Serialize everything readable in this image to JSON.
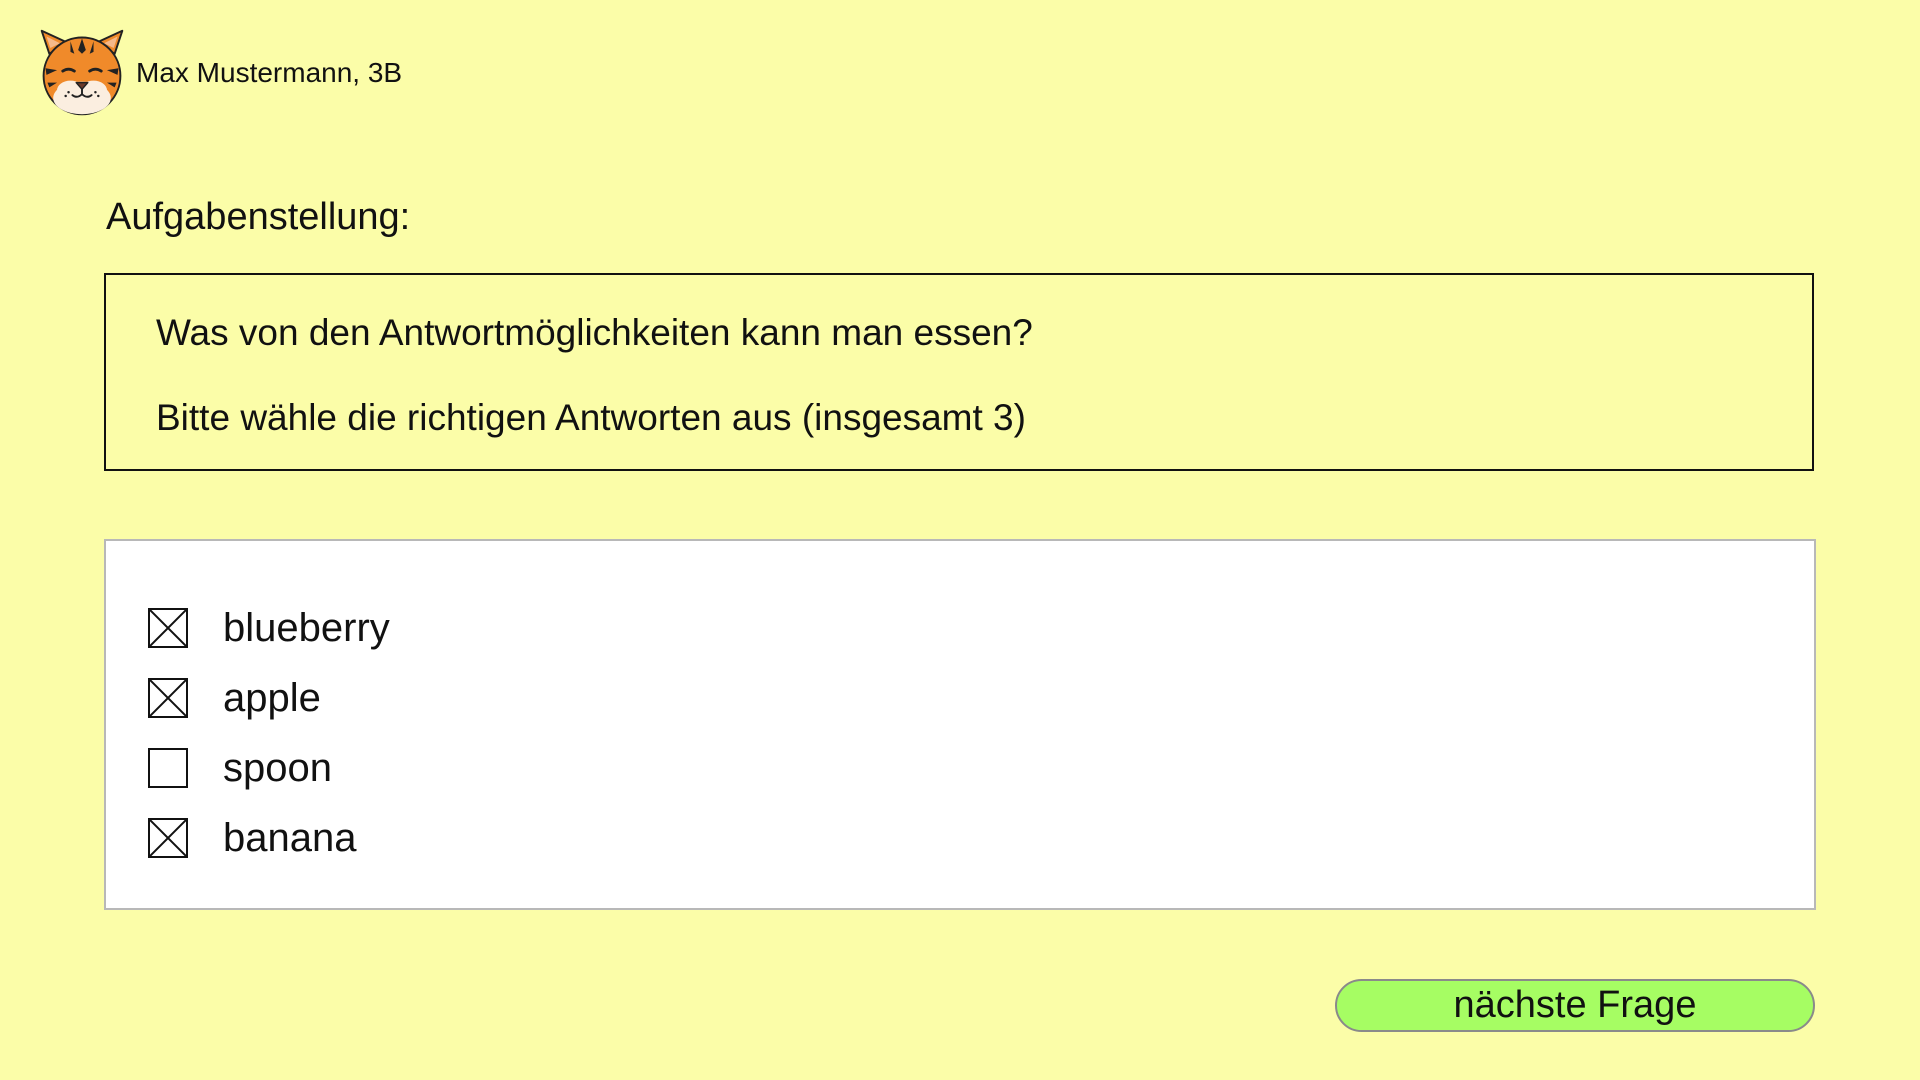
{
  "user": {
    "avatar_icon": "tiger-face-icon",
    "name": "Max Mustermann, 3B"
  },
  "task": {
    "heading": "Aufgabenstellung:",
    "question": "Was von den Antwortmöglichkeiten kann man essen?",
    "instruction": "Bitte wähle die richtigen Antworten aus (insgesamt 3)"
  },
  "answers": [
    {
      "label": "blueberry",
      "checked": true
    },
    {
      "label": "apple",
      "checked": true
    },
    {
      "label": "spoon",
      "checked": false
    },
    {
      "label": "banana",
      "checked": true
    }
  ],
  "next_button": {
    "label": "nächste Frage"
  },
  "colors": {
    "background": "#fbfda8",
    "button": "#a6fd63",
    "answers_panel": "#ffffff"
  }
}
